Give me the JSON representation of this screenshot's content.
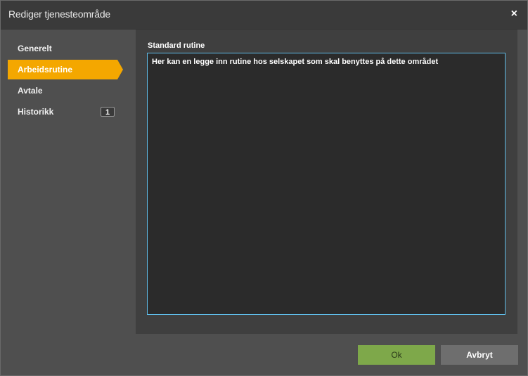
{
  "dialog": {
    "title": "Rediger tjenesteområde",
    "close_glyph": "×"
  },
  "sidebar": {
    "items": [
      {
        "label": "Generelt"
      },
      {
        "label": "Arbeidsrutine",
        "active": true
      },
      {
        "label": "Avtale"
      },
      {
        "label": "Historikk",
        "badge": "1"
      }
    ]
  },
  "main": {
    "field_label": "Standard rutine",
    "textarea_value": "Her kan en legge inn rutine hos selskapet som skal benyttes på dette området"
  },
  "footer": {
    "ok_label": "Ok",
    "cancel_label": "Avbryt"
  },
  "colors": {
    "accent": "#f4a700",
    "ok": "#7ea84a",
    "focus_border": "#5fbde9"
  }
}
